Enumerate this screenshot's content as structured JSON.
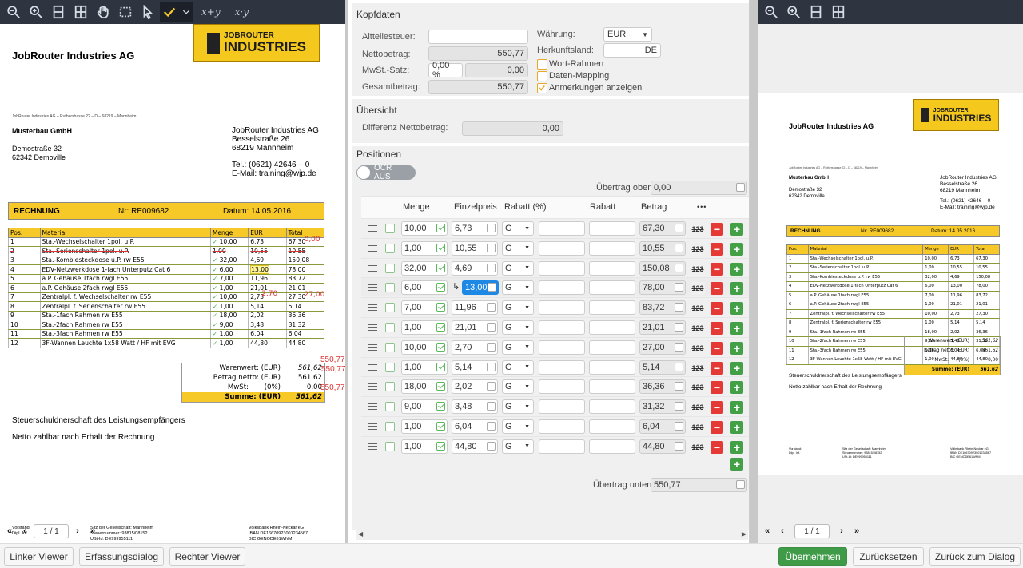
{
  "left_viewer": {
    "toolbar": {
      "sum_x_label": "x+y",
      "sum_xy_label": "x·y"
    },
    "doc": {
      "company": "JobRouter Industries AG",
      "logo_top": "JOBROUTER",
      "logo_bottom": "INDUSTRIES",
      "sender_line": "JobRouter Industries AG – Ruthersbasse 22 – D – 68219 – Mannheim",
      "recipient": {
        "name": "Musterbau GmbH",
        "street": "Demostraße 32",
        "city": "62342 Demoville"
      },
      "sender": {
        "name": "JobRouter Industries AG",
        "street": "Besselstraße 26",
        "city": "68219 Mannheim",
        "tel": "Tel.: (0621) 42646 – 0",
        "email": "E-Mail: training@wjp.de"
      },
      "invoice": {
        "title": "RECHNUNG",
        "number": "Nr: RE009682",
        "date": "Datum: 14.05.2016"
      },
      "columns": [
        "Pos.",
        "Material",
        "Menge",
        "EUR",
        "Total"
      ],
      "rows": [
        {
          "pos": "1",
          "material": "Sta.-Wechselschalter 1pol. u.P.",
          "menge": "10,00",
          "eur": "6,73",
          "total": "67,30",
          "note": "0,00"
        },
        {
          "pos": "2",
          "material": "Sta.-Serienschalter 1pol. u.P.",
          "menge": "1,00",
          "eur": "10,55",
          "total": "10,55",
          "note": ""
        },
        {
          "pos": "3",
          "material": "Sta.-Kombiesteckdose u.P. rw E55",
          "menge": "32,00",
          "eur": "4,69",
          "total": "150,08",
          "note": ""
        },
        {
          "pos": "4",
          "material": "EDV-Netzwerkdose 1-fach Unterputz Cat 6",
          "menge": "6,00",
          "eur": "13,00",
          "total": "78,00",
          "note": ""
        },
        {
          "pos": "5",
          "material": "a.P. Gehäuse 1fach rwgl E55",
          "menge": "7,00",
          "eur": "11,96",
          "total": "83,72",
          "note": ""
        },
        {
          "pos": "6",
          "material": "a.P. Gehäuse 2fach rwgl E55",
          "menge": "1,00",
          "eur": "21,01",
          "total": "21,01",
          "note": ""
        },
        {
          "pos": "7",
          "material": "Zentralpl. f. Wechselschalter rw E55",
          "menge": "10,00",
          "eur": "2,73",
          "total": "27,30",
          "note": "27,00",
          "note2": "2,70"
        },
        {
          "pos": "8",
          "material": "Zentralpl. f. Serienschalter rw E55",
          "menge": "1,00",
          "eur": "5,14",
          "total": "5,14",
          "note": ""
        },
        {
          "pos": "9",
          "material": "Sta.-1fach Rahmen rw E55",
          "menge": "18,00",
          "eur": "2,02",
          "total": "36,36",
          "note": ""
        },
        {
          "pos": "10",
          "material": "Sta.-2fach Rahmen rw E55",
          "menge": "9,00",
          "eur": "3,48",
          "total": "31,32",
          "note": ""
        },
        {
          "pos": "11",
          "material": "Sta.-3fach Rahmen rw E55",
          "menge": "1,00",
          "eur": "6,04",
          "total": "6,04",
          "note": ""
        },
        {
          "pos": "12",
          "material": "3F-Wannen Leuchte 1x58 Watt / HF mit EVG",
          "menge": "1,00",
          "eur": "44,80",
          "total": "44,80",
          "note": ""
        }
      ],
      "totals": {
        "warenwert_label": "Warenwert: (EUR)",
        "warenwert": "561,62",
        "netto_label": "Betrag netto: (EUR)",
        "netto": "561,62",
        "mwst_label": "MwSt:",
        "mwst_pct": "(0%)",
        "mwst": "0,00",
        "summe_label": "Summe: (EUR)",
        "summe": "561,62",
        "note_a": "550,77",
        "note_b": "550,77",
        "note_c": "550,77"
      },
      "text1": "Steuerschuldnerschaft des Leistungsempfängers",
      "text2": "Netto zahlbar nach Erhalt der Rechnung",
      "footer": {
        "col1": [
          "Vorstand:",
          "Dipl. Inf."
        ],
        "col2": [
          "Sitz der Gesellschaft: Mannheim",
          "Steuernummer: 93815/08152",
          "USt-Id: DE999955111"
        ],
        "col3": [
          "Volksbank Rhein-Neckar eG",
          "IBAN DE16670923001234567",
          "BIC GENODE61WNM"
        ]
      }
    },
    "pager": {
      "value": "1 / 1"
    }
  },
  "center": {
    "kopfdaten": {
      "title": "Kopfdaten",
      "altteilesteuer_label": "Altteilesteuer:",
      "altteilesteuer_value": "",
      "nettobetrag_label": "Nettobetrag:",
      "nettobetrag_value": "550,77",
      "mwst_label": "MwSt.-Satz:",
      "mwst_pct": "0,00 %",
      "mwst_value": "0,00",
      "gesamt_label": "Gesamtbetrag:",
      "gesamt_value": "550,77",
      "waehrung_label": "Währung:",
      "waehrung_value": "EUR",
      "herkunft_label": "Herkunftsland:",
      "herkunft_value": "DE",
      "opt_wort": "Wort-Rahmen",
      "opt_daten": "Daten-Mapping",
      "opt_anm": "Anmerkungen anzeigen"
    },
    "uebersicht": {
      "title": "Übersicht",
      "diff_label": "Differenz Nettobetrag:",
      "diff_value": "0,00"
    },
    "positionen": {
      "title": "Positionen",
      "ocr_label": "OCR AUS",
      "uebertrag_oben_label": "Übertrag oben:",
      "uebertrag_oben": "0,00",
      "uebertrag_unten_label": "Übertrag unten:",
      "uebertrag_unten": "550,77",
      "columns": {
        "menge": "Menge",
        "einzelpreis": "Einzelpreis",
        "rabatt_pct": "Rabatt (%)",
        "rabatt": "Rabatt",
        "betrag": "Betrag",
        "more": "•••"
      },
      "rows": [
        {
          "menge": "10,00",
          "preis": "6,73",
          "typ": "G",
          "betrag": "67,30",
          "struck": false,
          "active": false
        },
        {
          "menge": "1,00",
          "preis": "10,55",
          "typ": "G",
          "betrag": "10,55",
          "struck": true,
          "active": false
        },
        {
          "menge": "32,00",
          "preis": "4,69",
          "typ": "G",
          "betrag": "150,08",
          "struck": false,
          "active": false
        },
        {
          "menge": "6,00",
          "preis": "13,00",
          "typ": "G",
          "betrag": "78,00",
          "struck": false,
          "active": true
        },
        {
          "menge": "7,00",
          "preis": "11,96",
          "typ": "G",
          "betrag": "83,72",
          "struck": false,
          "active": false
        },
        {
          "menge": "1,00",
          "preis": "21,01",
          "typ": "G",
          "betrag": "21,01",
          "struck": false,
          "active": false
        },
        {
          "menge": "10,00",
          "preis": "2,70",
          "typ": "G",
          "betrag": "27,00",
          "struck": false,
          "active": false
        },
        {
          "menge": "1,00",
          "preis": "5,14",
          "typ": "G",
          "betrag": "5,14",
          "struck": false,
          "active": false
        },
        {
          "menge": "18,00",
          "preis": "2,02",
          "typ": "G",
          "betrag": "36,36",
          "struck": false,
          "active": false
        },
        {
          "menge": "9,00",
          "preis": "3,48",
          "typ": "G",
          "betrag": "31,32",
          "struck": false,
          "active": false
        },
        {
          "menge": "1,00",
          "preis": "6,04",
          "typ": "G",
          "betrag": "6,04",
          "struck": false,
          "active": false
        },
        {
          "menge": "1,00",
          "preis": "44,80",
          "typ": "G",
          "betrag": "44,80",
          "struck": false,
          "active": false
        }
      ],
      "btn_123": "123"
    }
  },
  "right_viewer": {
    "pager": {
      "value": "1 / 1"
    }
  },
  "bottom": {
    "linker_viewer": "Linker Viewer",
    "erfassungsdialog": "Erfassungsdialog",
    "rechter_viewer": "Rechter Viewer",
    "uebernehmen": "Übernehmen",
    "zuruecksetzen": "Zurücksetzen",
    "zurueck": "Zurück zum Dialog"
  },
  "colors": {
    "accent": "#f6c928",
    "toolbar": "#2e3440",
    "ok": "#43a047",
    "danger": "#e53935",
    "active_input": "#1e88e5"
  }
}
